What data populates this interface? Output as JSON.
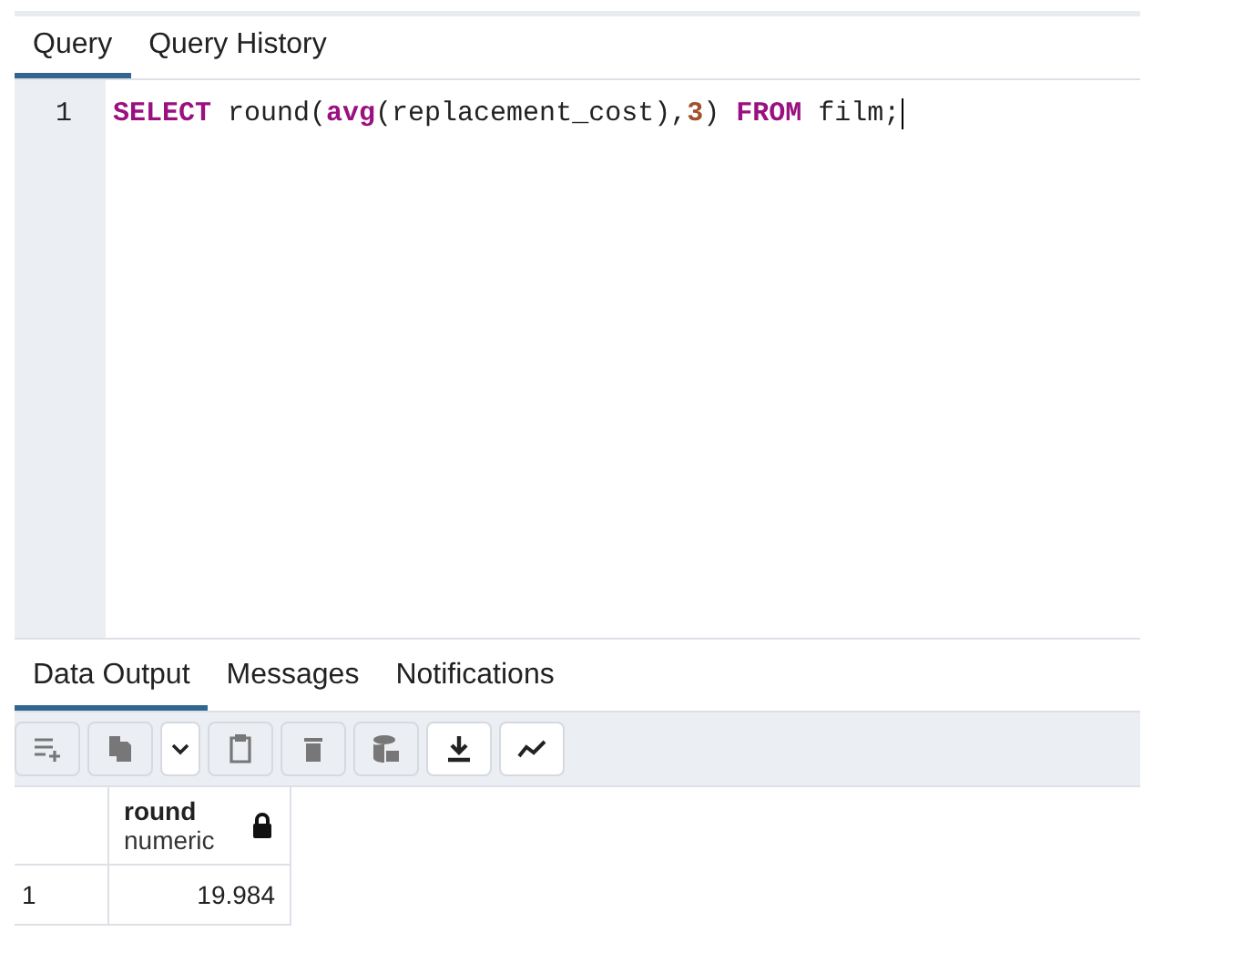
{
  "query_tabs": [
    {
      "label": "Query",
      "selected": true
    },
    {
      "label": "Query History",
      "selected": false
    }
  ],
  "editor": {
    "lines": [
      {
        "number": "1",
        "tokens": [
          {
            "text": "SELECT",
            "kind": "keyword"
          },
          {
            "text": " round(",
            "kind": "plain"
          },
          {
            "text": "avg",
            "kind": "function"
          },
          {
            "text": "(replacement_cost),",
            "kind": "plain"
          },
          {
            "text": "3",
            "kind": "number"
          },
          {
            "text": ") ",
            "kind": "plain"
          },
          {
            "text": "FROM",
            "kind": "keyword"
          },
          {
            "text": " film;",
            "kind": "plain"
          }
        ]
      }
    ]
  },
  "output_tabs": [
    {
      "label": "Data Output",
      "selected": true
    },
    {
      "label": "Messages",
      "selected": false
    },
    {
      "label": "Notifications",
      "selected": false
    }
  ],
  "toolbar": [
    {
      "kind": "add-row",
      "disabled": true
    },
    {
      "kind": "copy",
      "disabled": true
    },
    {
      "kind": "dropdown",
      "disabled": false
    },
    {
      "kind": "paste",
      "disabled": true
    },
    {
      "kind": "delete",
      "disabled": true
    },
    {
      "kind": "save-data",
      "disabled": true
    },
    {
      "kind": "download",
      "disabled": false
    },
    {
      "kind": "graph",
      "disabled": false
    }
  ],
  "table": {
    "columns": [
      {
        "name": "round",
        "type": "numeric",
        "locked": true
      }
    ],
    "rows": [
      {
        "number": "1",
        "cells": [
          "19.984"
        ]
      }
    ]
  }
}
